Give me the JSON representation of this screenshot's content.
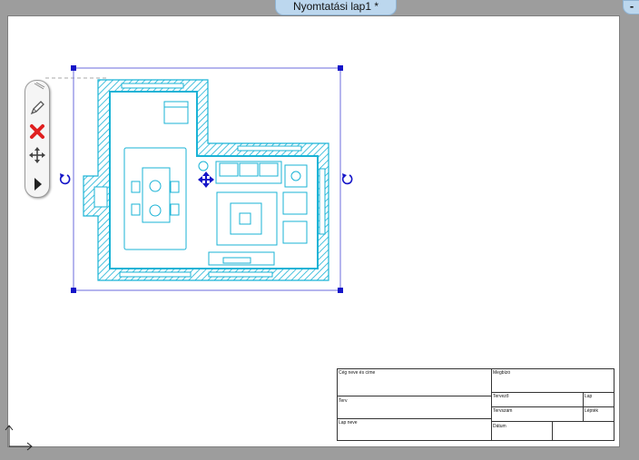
{
  "window": {
    "tab_title": "Nyomtatási lap1 *",
    "minimize_label": "-"
  },
  "toolbar": {
    "items": [
      {
        "icon": "pencil-icon"
      },
      {
        "icon": "close-icon"
      },
      {
        "icon": "move-icon"
      },
      {
        "icon": "play-icon"
      }
    ]
  },
  "title_block": {
    "company": "Cég neve és címe",
    "client": "Megbízó",
    "project": "Terv",
    "designer": "Tervező",
    "sheet": "Lap",
    "drawing_name": "Lap neve",
    "scale": "Lépték",
    "date": "Dátum",
    "approved": "Tervszám"
  },
  "colors": {
    "plan": "#1ab3d6",
    "selection": "#1515c8",
    "background": "#9d9d9d",
    "tab": "#bcd7ee"
  }
}
